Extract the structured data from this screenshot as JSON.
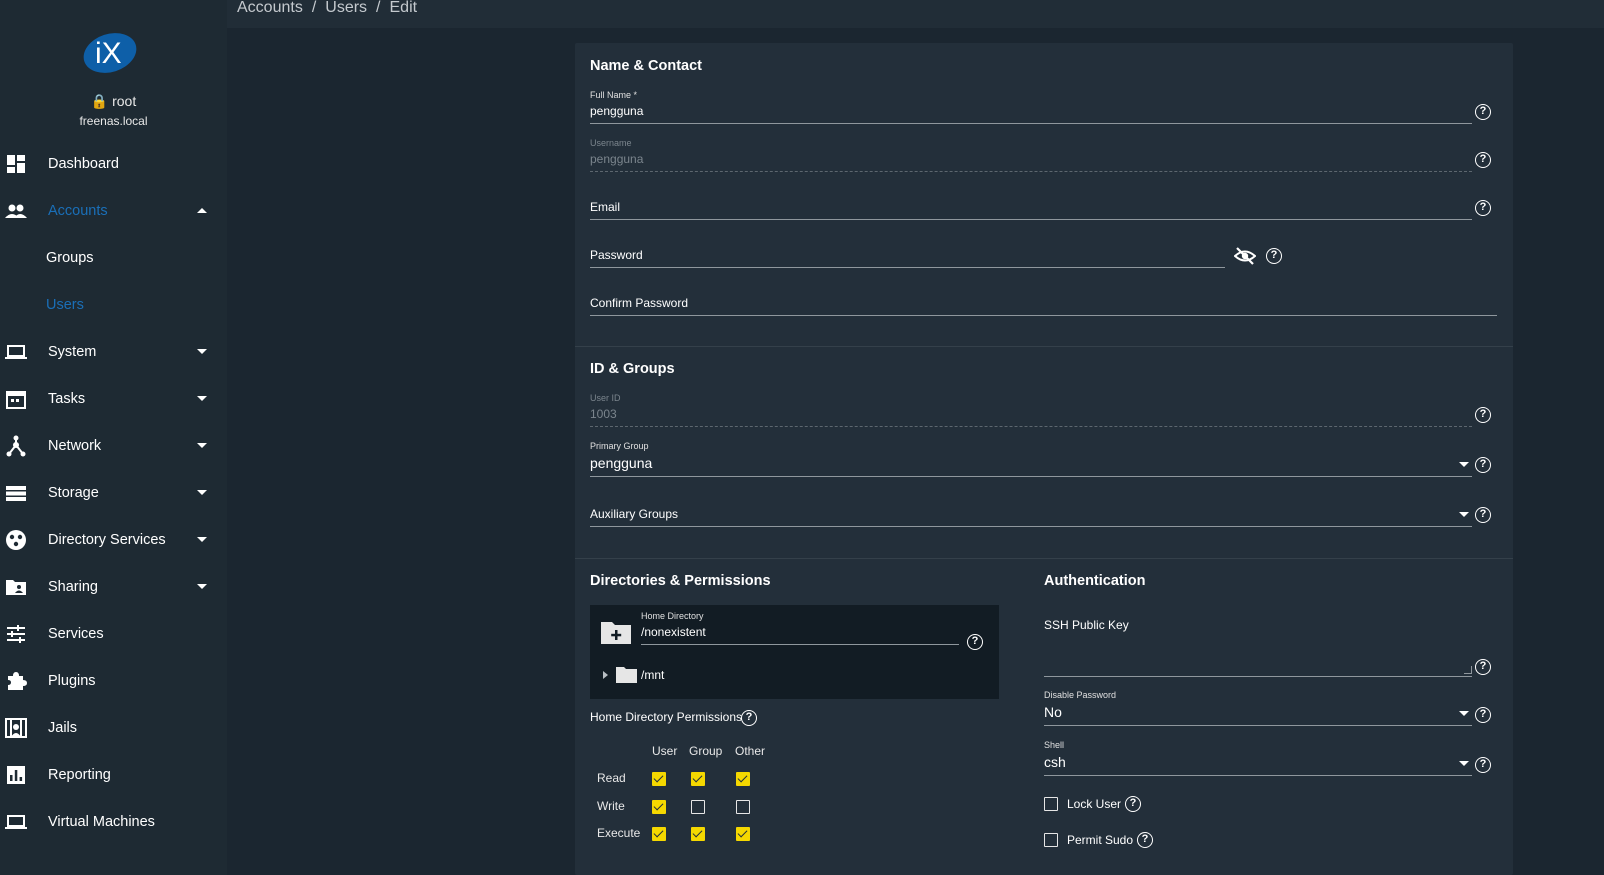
{
  "sidebar": {
    "user": "root",
    "host": "freenas.local",
    "items": [
      {
        "label": "Dashboard"
      },
      {
        "label": "Accounts"
      },
      {
        "label": "Groups"
      },
      {
        "label": "Users"
      },
      {
        "label": "System"
      },
      {
        "label": "Tasks"
      },
      {
        "label": "Network"
      },
      {
        "label": "Storage"
      },
      {
        "label": "Directory Services"
      },
      {
        "label": "Sharing"
      },
      {
        "label": "Services"
      },
      {
        "label": "Plugins"
      },
      {
        "label": "Jails"
      },
      {
        "label": "Reporting"
      },
      {
        "label": "Virtual Machines"
      }
    ]
  },
  "breadcrumb": [
    "Accounts",
    "Users",
    "Edit"
  ],
  "name_contact": {
    "title": "Name & Contact",
    "full_name_label": "Full Name *",
    "full_name_value": "pengguna",
    "username_label": "Username",
    "username_value": "pengguna",
    "email_label": "Email",
    "password_label": "Password",
    "confirm_password_label": "Confirm Password"
  },
  "id_groups": {
    "title": "ID & Groups",
    "user_id_label": "User ID",
    "user_id_value": "1003",
    "primary_group_label": "Primary Group",
    "primary_group_value": "pengguna",
    "aux_groups_label": "Auxiliary Groups"
  },
  "directories": {
    "title": "Directories & Permissions",
    "home_dir_label": "Home Directory",
    "home_dir_value": "/nonexistent",
    "tree_item": "/mnt",
    "perm_title": "Home Directory Permissions",
    "columns": [
      "User",
      "Group",
      "Other"
    ],
    "rows": [
      {
        "label": "Read",
        "values": [
          true,
          true,
          true
        ]
      },
      {
        "label": "Write",
        "values": [
          true,
          false,
          false
        ]
      },
      {
        "label": "Execute",
        "values": [
          true,
          true,
          true
        ]
      }
    ]
  },
  "authentication": {
    "title": "Authentication",
    "ssh_label": "SSH Public Key",
    "disable_password_label": "Disable Password",
    "disable_password_value": "No",
    "shell_label": "Shell",
    "shell_value": "csh",
    "lock_user_label": "Lock User",
    "permit_sudo_label": "Permit Sudo"
  },
  "colors": {
    "accent": "#1a6fb8",
    "checkbox": "#f5d800",
    "background": "#1b2630",
    "card": "#232f3a"
  }
}
